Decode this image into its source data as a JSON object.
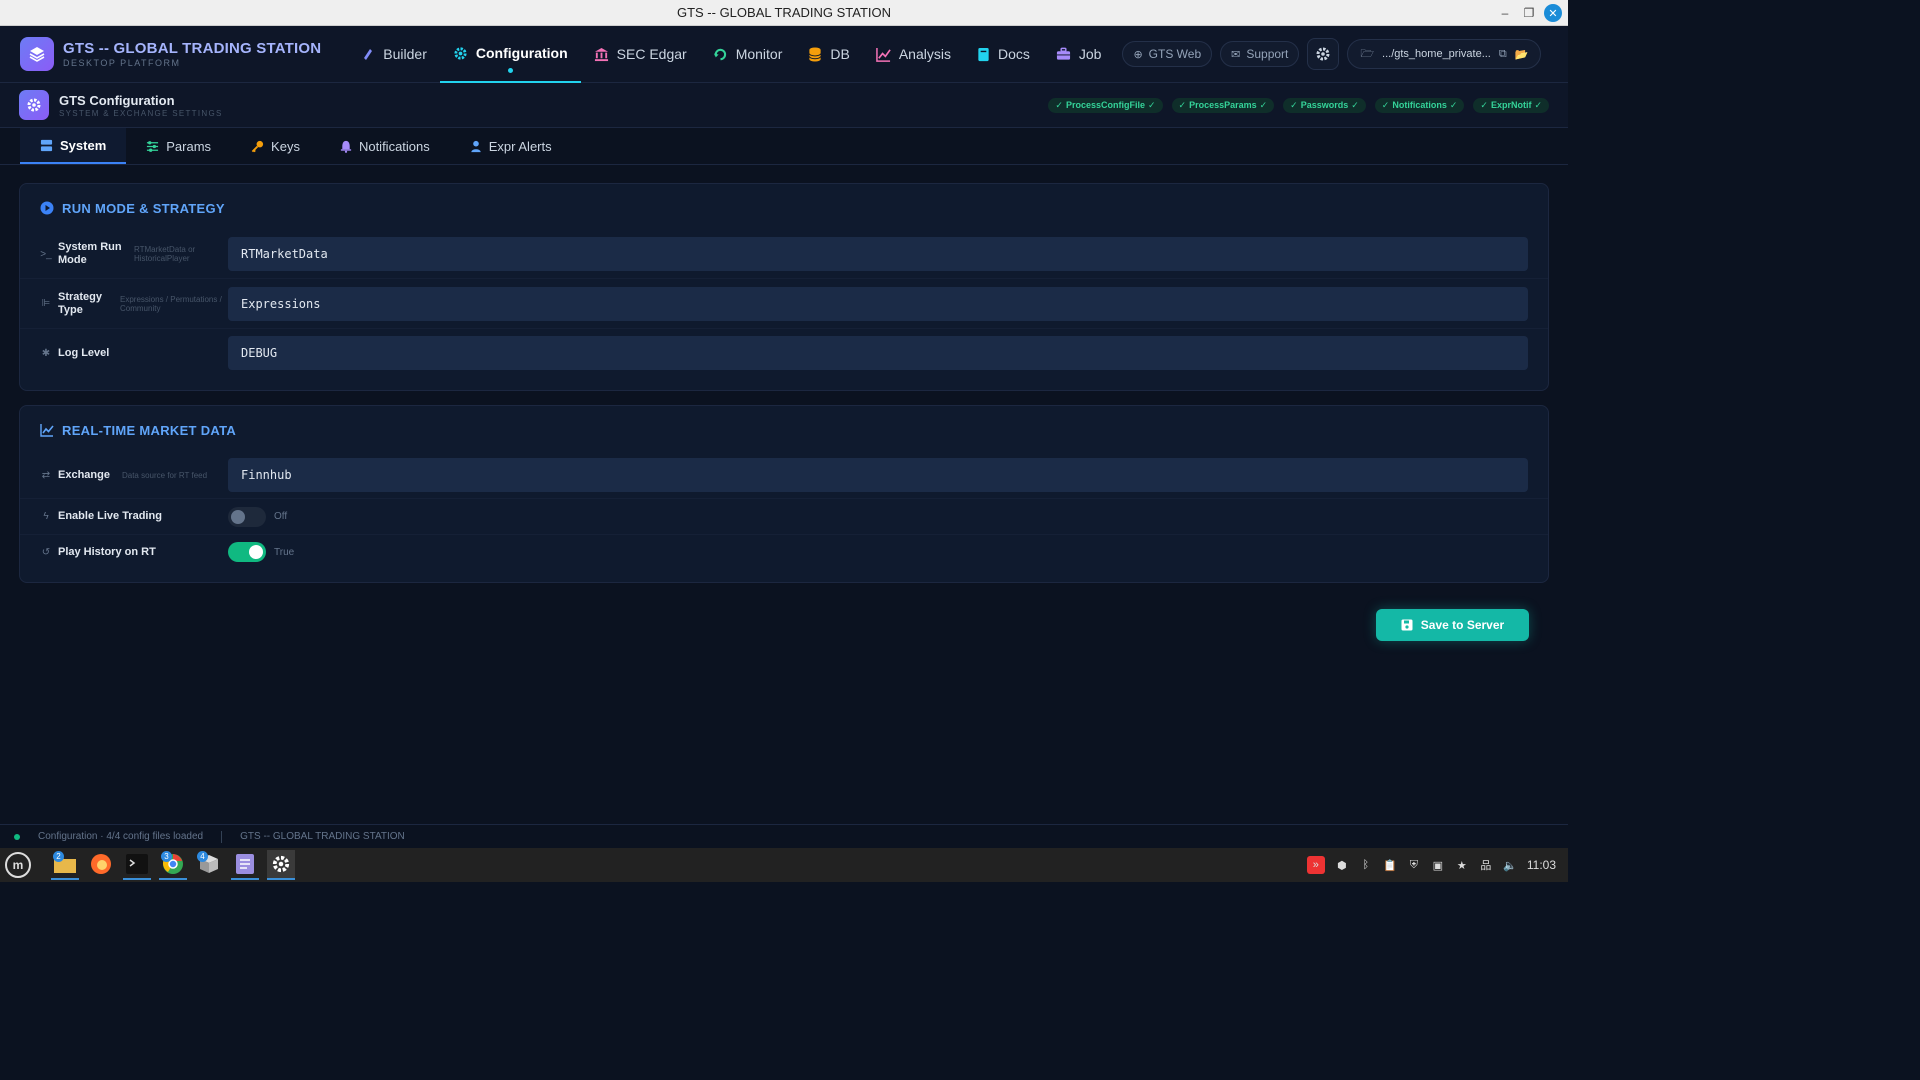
{
  "window": {
    "title": "GTS -- GLOBAL TRADING STATION"
  },
  "brand": {
    "title": "GTS -- GLOBAL TRADING STATION",
    "subtitle": "DESKTOP PLATFORM"
  },
  "nav": {
    "items": [
      {
        "label": "Builder",
        "icon": "pen-icon",
        "color": "#818cf8"
      },
      {
        "label": "Configuration",
        "icon": "gear-icon",
        "color": "#22d3ee"
      },
      {
        "label": "SEC Edgar",
        "icon": "bank-icon",
        "color": "#f472b6"
      },
      {
        "label": "Monitor",
        "icon": "refresh-icon",
        "color": "#34d399"
      },
      {
        "label": "DB",
        "icon": "database-icon",
        "color": "#f59e0b"
      },
      {
        "label": "Analysis",
        "icon": "chart-line-icon",
        "color": "#f472b6"
      },
      {
        "label": "Docs",
        "icon": "book-icon",
        "color": "#22d3ee"
      },
      {
        "label": "Job",
        "icon": "briefcase-icon",
        "color": "#a78bfa"
      }
    ],
    "gts_web": "GTS Web",
    "support": "Support",
    "path": ".../gts_home_private..."
  },
  "config_header": {
    "title": "GTS Configuration",
    "subtitle": "SYSTEM & EXCHANGE SETTINGS",
    "badges": [
      "ProcessConfigFile",
      "ProcessParams",
      "Passwords",
      "Notifications",
      "ExprNotif"
    ]
  },
  "tabs": [
    "System",
    "Params",
    "Keys",
    "Notifications",
    "Expr Alerts"
  ],
  "run_mode": {
    "title": "RUN MODE & STRATEGY",
    "system_run_mode": {
      "label": "System Run Mode",
      "hint": "RTMarketData or HistoricalPlayer",
      "value": "RTMarketData"
    },
    "strategy_type": {
      "label": "Strategy Type",
      "hint": "Expressions / Permutations / Community",
      "value": "Expressions"
    },
    "log_level": {
      "label": "Log Level",
      "value": "DEBUG"
    }
  },
  "market_data": {
    "title": "REAL-TIME MARKET DATA",
    "exchange": {
      "label": "Exchange",
      "hint": "Data source for RT feed",
      "value": "Finnhub"
    },
    "live_trading": {
      "label": "Enable Live Trading",
      "state": "Off"
    },
    "play_history": {
      "label": "Play History on RT",
      "state": "True"
    }
  },
  "save_button": "Save to Server",
  "status": {
    "left": "Configuration · 4/4 config files loaded",
    "right": "GTS -- GLOBAL TRADING STATION"
  },
  "taskbar": {
    "clock": "11:03",
    "badge_files": "2",
    "badge_chrome": "3",
    "badge_app": "4"
  }
}
